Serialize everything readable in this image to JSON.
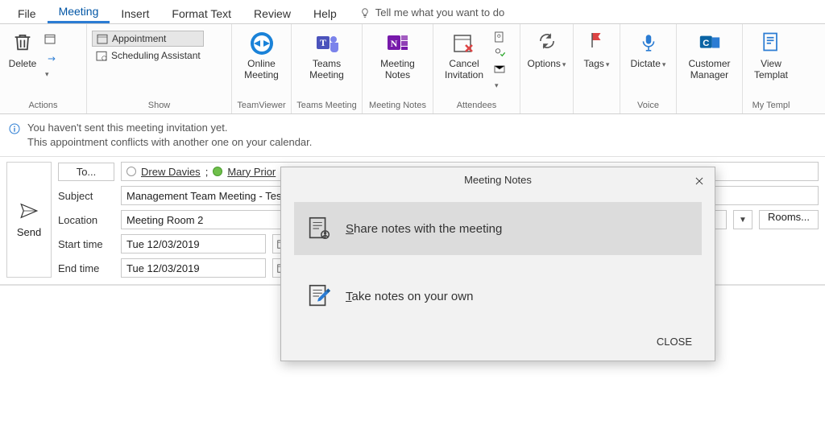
{
  "tabs": {
    "file": "File",
    "meeting": "Meeting",
    "insert": "Insert",
    "formatText": "Format Text",
    "review": "Review",
    "help": "Help",
    "tellMe": "Tell me what you want to do"
  },
  "ribbon": {
    "actions": {
      "label": "Actions",
      "delete": "Delete"
    },
    "show": {
      "label": "Show",
      "appointment": "Appointment",
      "scheduling": "Scheduling Assistant"
    },
    "teamviewer": {
      "label": "TeamViewer",
      "button": "Online\nMeeting"
    },
    "teamsMeeting": {
      "label": "Teams Meeting",
      "button": "Teams\nMeeting"
    },
    "meetingNotes": {
      "label": "Meeting Notes",
      "button": "Meeting\nNotes"
    },
    "attendees": {
      "label": "Attendees",
      "cancel": "Cancel\nInvitation"
    },
    "options": {
      "label": " ",
      "button": "Options"
    },
    "tags": {
      "label": " ",
      "button": "Tags"
    },
    "voice": {
      "label": "Voice",
      "button": "Dictate"
    },
    "customer": {
      "label": " ",
      "button": "Customer\nManager"
    },
    "templates": {
      "label": "My Templ",
      "button": "View\nTemplat"
    }
  },
  "infobar": {
    "line1": "You haven't sent this meeting invitation yet.",
    "line2": "This appointment conflicts with another one on your calendar."
  },
  "form": {
    "send": "Send",
    "toLabel": "To...",
    "attendee1": "Drew Davies",
    "attendee2": "Mary Prior",
    "subjectLabel": "Subject",
    "subjectValue": "Management Team Meeting - Testin",
    "locationLabel": "Location",
    "locationValue": "Meeting Room 2",
    "roomsLabel": "Rooms...",
    "startLabel": "Start time",
    "startValue": "Tue 12/03/2019",
    "endLabel": "End time",
    "endValue": "Tue 12/03/2019"
  },
  "modal": {
    "title": "Meeting Notes",
    "option1": "Share notes with the meeting",
    "option2": "Take notes on your own",
    "close": "CLOSE"
  }
}
